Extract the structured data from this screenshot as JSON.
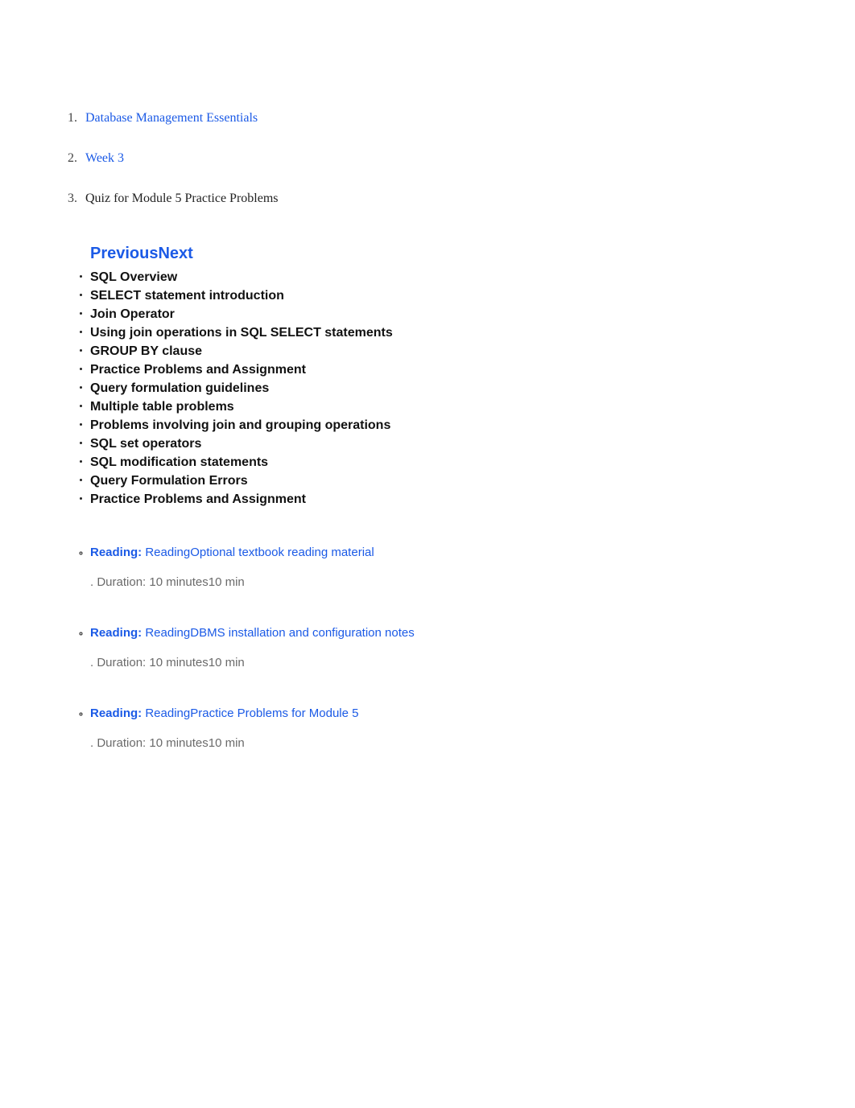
{
  "breadcrumb": {
    "items": [
      {
        "label": "Database Management Essentials",
        "is_link": true
      },
      {
        "label": "Week 3",
        "is_link": true
      },
      {
        "label": "Quiz for Module 5 Practice Problems",
        "is_link": false
      }
    ]
  },
  "nav": {
    "previous": "Previous",
    "next": "Next"
  },
  "topics": [
    {
      "label": "SQL Overview"
    },
    {
      "label": "SELECT statement introduction"
    },
    {
      "label": "Join Operator"
    },
    {
      "label": "Using join operations in SQL SELECT statements"
    },
    {
      "label": "GROUP BY clause"
    },
    {
      "label": "Practice Problems and Assignment"
    },
    {
      "label": "Query formulation guidelines"
    },
    {
      "label": "Multiple table problems"
    },
    {
      "label": "Problems involving join and grouping operations"
    },
    {
      "label": "SQL set operators"
    },
    {
      "label": "SQL modification statements"
    },
    {
      "label": "Query Formulation Errors"
    },
    {
      "label": "Practice Problems and Assignment"
    }
  ],
  "readings": [
    {
      "prefix": "Reading: ",
      "kind": "Reading",
      "title": "Optional textbook reading material",
      "duration_prefix": ". Duration: 10 minutes",
      "duration_short": "10 min"
    },
    {
      "prefix": "Reading: ",
      "kind": "Reading",
      "title": "DBMS installation and configuration notes",
      "duration_prefix": ". Duration: 10 minutes",
      "duration_short": "10 min"
    },
    {
      "prefix": "Reading: ",
      "kind": "Reading",
      "title": "Practice Problems for Module 5",
      "duration_prefix": ". Duration: 10 minutes",
      "duration_short": "10 min"
    }
  ]
}
